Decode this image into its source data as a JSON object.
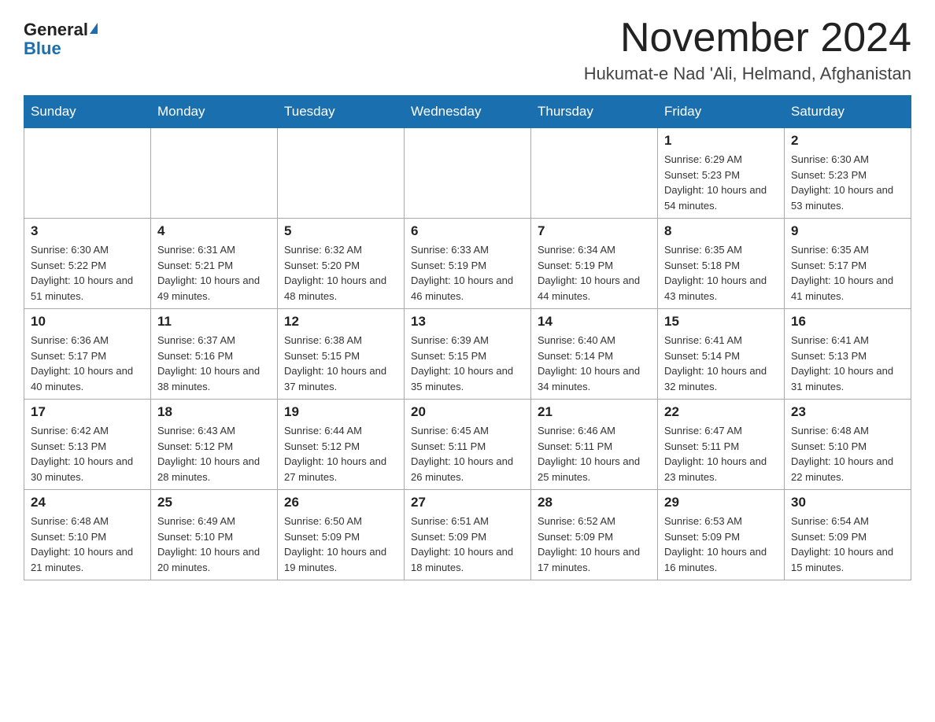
{
  "logo": {
    "general": "General",
    "blue": "Blue"
  },
  "header": {
    "month_year": "November 2024",
    "location": "Hukumat-e Nad 'Ali, Helmand, Afghanistan"
  },
  "days_of_week": [
    "Sunday",
    "Monday",
    "Tuesday",
    "Wednesday",
    "Thursday",
    "Friday",
    "Saturday"
  ],
  "weeks": [
    [
      {
        "day": "",
        "info": ""
      },
      {
        "day": "",
        "info": ""
      },
      {
        "day": "",
        "info": ""
      },
      {
        "day": "",
        "info": ""
      },
      {
        "day": "",
        "info": ""
      },
      {
        "day": "1",
        "info": "Sunrise: 6:29 AM\nSunset: 5:23 PM\nDaylight: 10 hours and 54 minutes."
      },
      {
        "day": "2",
        "info": "Sunrise: 6:30 AM\nSunset: 5:23 PM\nDaylight: 10 hours and 53 minutes."
      }
    ],
    [
      {
        "day": "3",
        "info": "Sunrise: 6:30 AM\nSunset: 5:22 PM\nDaylight: 10 hours and 51 minutes."
      },
      {
        "day": "4",
        "info": "Sunrise: 6:31 AM\nSunset: 5:21 PM\nDaylight: 10 hours and 49 minutes."
      },
      {
        "day": "5",
        "info": "Sunrise: 6:32 AM\nSunset: 5:20 PM\nDaylight: 10 hours and 48 minutes."
      },
      {
        "day": "6",
        "info": "Sunrise: 6:33 AM\nSunset: 5:19 PM\nDaylight: 10 hours and 46 minutes."
      },
      {
        "day": "7",
        "info": "Sunrise: 6:34 AM\nSunset: 5:19 PM\nDaylight: 10 hours and 44 minutes."
      },
      {
        "day": "8",
        "info": "Sunrise: 6:35 AM\nSunset: 5:18 PM\nDaylight: 10 hours and 43 minutes."
      },
      {
        "day": "9",
        "info": "Sunrise: 6:35 AM\nSunset: 5:17 PM\nDaylight: 10 hours and 41 minutes."
      }
    ],
    [
      {
        "day": "10",
        "info": "Sunrise: 6:36 AM\nSunset: 5:17 PM\nDaylight: 10 hours and 40 minutes."
      },
      {
        "day": "11",
        "info": "Sunrise: 6:37 AM\nSunset: 5:16 PM\nDaylight: 10 hours and 38 minutes."
      },
      {
        "day": "12",
        "info": "Sunrise: 6:38 AM\nSunset: 5:15 PM\nDaylight: 10 hours and 37 minutes."
      },
      {
        "day": "13",
        "info": "Sunrise: 6:39 AM\nSunset: 5:15 PM\nDaylight: 10 hours and 35 minutes."
      },
      {
        "day": "14",
        "info": "Sunrise: 6:40 AM\nSunset: 5:14 PM\nDaylight: 10 hours and 34 minutes."
      },
      {
        "day": "15",
        "info": "Sunrise: 6:41 AM\nSunset: 5:14 PM\nDaylight: 10 hours and 32 minutes."
      },
      {
        "day": "16",
        "info": "Sunrise: 6:41 AM\nSunset: 5:13 PM\nDaylight: 10 hours and 31 minutes."
      }
    ],
    [
      {
        "day": "17",
        "info": "Sunrise: 6:42 AM\nSunset: 5:13 PM\nDaylight: 10 hours and 30 minutes."
      },
      {
        "day": "18",
        "info": "Sunrise: 6:43 AM\nSunset: 5:12 PM\nDaylight: 10 hours and 28 minutes."
      },
      {
        "day": "19",
        "info": "Sunrise: 6:44 AM\nSunset: 5:12 PM\nDaylight: 10 hours and 27 minutes."
      },
      {
        "day": "20",
        "info": "Sunrise: 6:45 AM\nSunset: 5:11 PM\nDaylight: 10 hours and 26 minutes."
      },
      {
        "day": "21",
        "info": "Sunrise: 6:46 AM\nSunset: 5:11 PM\nDaylight: 10 hours and 25 minutes."
      },
      {
        "day": "22",
        "info": "Sunrise: 6:47 AM\nSunset: 5:11 PM\nDaylight: 10 hours and 23 minutes."
      },
      {
        "day": "23",
        "info": "Sunrise: 6:48 AM\nSunset: 5:10 PM\nDaylight: 10 hours and 22 minutes."
      }
    ],
    [
      {
        "day": "24",
        "info": "Sunrise: 6:48 AM\nSunset: 5:10 PM\nDaylight: 10 hours and 21 minutes."
      },
      {
        "day": "25",
        "info": "Sunrise: 6:49 AM\nSunset: 5:10 PM\nDaylight: 10 hours and 20 minutes."
      },
      {
        "day": "26",
        "info": "Sunrise: 6:50 AM\nSunset: 5:09 PM\nDaylight: 10 hours and 19 minutes."
      },
      {
        "day": "27",
        "info": "Sunrise: 6:51 AM\nSunset: 5:09 PM\nDaylight: 10 hours and 18 minutes."
      },
      {
        "day": "28",
        "info": "Sunrise: 6:52 AM\nSunset: 5:09 PM\nDaylight: 10 hours and 17 minutes."
      },
      {
        "day": "29",
        "info": "Sunrise: 6:53 AM\nSunset: 5:09 PM\nDaylight: 10 hours and 16 minutes."
      },
      {
        "day": "30",
        "info": "Sunrise: 6:54 AM\nSunset: 5:09 PM\nDaylight: 10 hours and 15 minutes."
      }
    ]
  ]
}
